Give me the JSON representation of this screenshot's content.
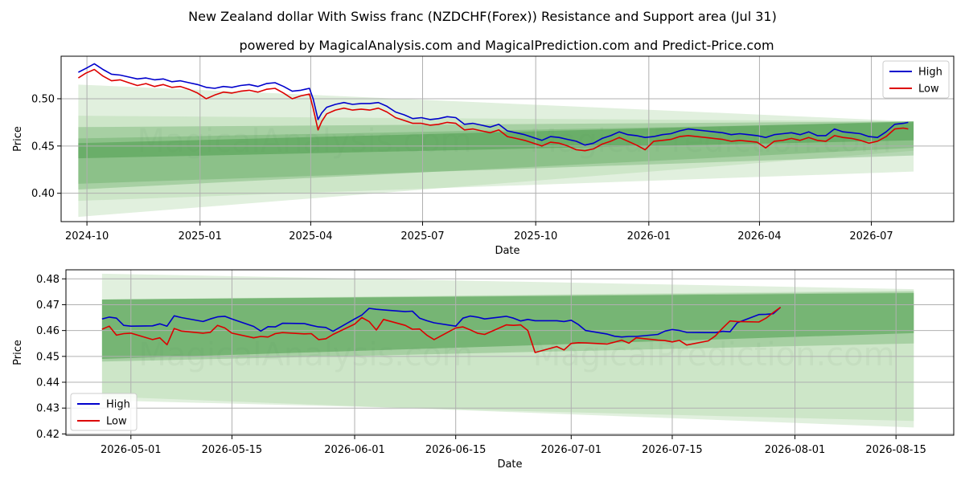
{
  "page": {
    "title": "New Zealand dollar With Swiss franc (NZDCHF(Forex)) Resistance and Support area (Jul 31)",
    "subtitle": "powered by MagicalAnalysis.com and MagicalPrediction.com and Predict-Price.com",
    "watermarks": [
      "MagicalAnalysis.com",
      "MagicalPrediction.com"
    ]
  },
  "colors": {
    "high": "#0000cc",
    "low": "#dd0000",
    "band_light": "#a8d5a0",
    "band_dark": "#4f9e4f",
    "grid": "#b0b0b0"
  },
  "chart_data": [
    {
      "type": "line",
      "xlabel": "Date",
      "ylabel": "Price",
      "ylim": [
        0.37,
        0.545
      ],
      "xlim": [
        "2024-09-10",
        "2026-09-06"
      ],
      "x_ticks": [
        "2024-10",
        "2025-01",
        "2025-04",
        "2025-07",
        "2025-10",
        "2026-01",
        "2026-04",
        "2026-07"
      ],
      "x_tick_dates": [
        "2024-10-01",
        "2025-01-01",
        "2025-04-01",
        "2025-07-01",
        "2025-10-01",
        "2026-01-01",
        "2026-04-01",
        "2026-07-01"
      ],
      "y_ticks": [
        "0.40",
        "0.45",
        "0.50"
      ],
      "y_tick_values": [
        0.4,
        0.45,
        0.5
      ],
      "grid": true,
      "legend_position": "top-right",
      "series": [
        {
          "name": "High",
          "dates": [
            "2024-09-24",
            "2024-09-30",
            "2024-10-07",
            "2024-10-14",
            "2024-10-21",
            "2024-10-28",
            "2024-11-04",
            "2024-11-11",
            "2024-11-18",
            "2024-11-25",
            "2024-12-02",
            "2024-12-09",
            "2024-12-16",
            "2024-12-23",
            "2024-12-30",
            "2025-01-06",
            "2025-01-13",
            "2025-01-20",
            "2025-01-27",
            "2025-02-03",
            "2025-02-10",
            "2025-02-17",
            "2025-02-24",
            "2025-03-03",
            "2025-03-10",
            "2025-03-17",
            "2025-03-24",
            "2025-03-31",
            "2025-04-03",
            "2025-04-07",
            "2025-04-10",
            "2025-04-14",
            "2025-04-21",
            "2025-04-28",
            "2025-05-05",
            "2025-05-12",
            "2025-05-19",
            "2025-05-26",
            "2025-06-02",
            "2025-06-09",
            "2025-06-16",
            "2025-06-23",
            "2025-06-30",
            "2025-07-07",
            "2025-07-14",
            "2025-07-21",
            "2025-07-28",
            "2025-08-04",
            "2025-08-11",
            "2025-08-18",
            "2025-08-25",
            "2025-09-01",
            "2025-09-08",
            "2025-09-15",
            "2025-09-22",
            "2025-09-29",
            "2025-10-06",
            "2025-10-13",
            "2025-10-20",
            "2025-10-27",
            "2025-11-03",
            "2025-11-10",
            "2025-11-17",
            "2025-11-24",
            "2025-12-01",
            "2025-12-08",
            "2025-12-15",
            "2025-12-22",
            "2025-12-29",
            "2026-01-05",
            "2026-01-12",
            "2026-01-19",
            "2026-01-26",
            "2026-02-02",
            "2026-02-09",
            "2026-02-16",
            "2026-02-23",
            "2026-03-02",
            "2026-03-09",
            "2026-03-16",
            "2026-03-23",
            "2026-03-30",
            "2026-04-06",
            "2026-04-13",
            "2026-04-20",
            "2026-04-27",
            "2026-05-04",
            "2026-05-11",
            "2026-05-18",
            "2026-05-25",
            "2026-06-01",
            "2026-06-08",
            "2026-06-15",
            "2026-06-22",
            "2026-06-29",
            "2026-07-06",
            "2026-07-13",
            "2026-07-20",
            "2026-07-27",
            "2026-07-31"
          ],
          "values": [
            0.528,
            0.532,
            0.537,
            0.531,
            0.526,
            0.525,
            0.523,
            0.521,
            0.522,
            0.52,
            0.521,
            0.518,
            0.519,
            0.517,
            0.515,
            0.512,
            0.511,
            0.513,
            0.512,
            0.514,
            0.515,
            0.513,
            0.516,
            0.517,
            0.513,
            0.508,
            0.509,
            0.511,
            0.5,
            0.478,
            0.485,
            0.491,
            0.494,
            0.496,
            0.494,
            0.495,
            0.495,
            0.496,
            0.492,
            0.486,
            0.483,
            0.479,
            0.48,
            0.478,
            0.479,
            0.481,
            0.48,
            0.473,
            0.474,
            0.472,
            0.47,
            0.473,
            0.466,
            0.464,
            0.462,
            0.459,
            0.456,
            0.46,
            0.459,
            0.457,
            0.455,
            0.451,
            0.453,
            0.458,
            0.461,
            0.465,
            0.462,
            0.461,
            0.459,
            0.46,
            0.462,
            0.463,
            0.466,
            0.468,
            0.467,
            0.466,
            0.465,
            0.464,
            0.462,
            0.463,
            0.462,
            0.461,
            0.459,
            0.462,
            0.463,
            0.464,
            0.462,
            0.465,
            0.461,
            0.461,
            0.468,
            0.465,
            0.464,
            0.463,
            0.46,
            0.459,
            0.465,
            0.473,
            0.474,
            0.475
          ]
        },
        {
          "name": "Low",
          "dates": [
            "2024-09-24",
            "2024-09-30",
            "2024-10-07",
            "2024-10-14",
            "2024-10-21",
            "2024-10-28",
            "2024-11-04",
            "2024-11-11",
            "2024-11-18",
            "2024-11-25",
            "2024-12-02",
            "2024-12-09",
            "2024-12-16",
            "2024-12-23",
            "2024-12-30",
            "2025-01-06",
            "2025-01-13",
            "2025-01-20",
            "2025-01-27",
            "2025-02-03",
            "2025-02-10",
            "2025-02-17",
            "2025-02-24",
            "2025-03-03",
            "2025-03-10",
            "2025-03-17",
            "2025-03-24",
            "2025-03-31",
            "2025-04-03",
            "2025-04-07",
            "2025-04-10",
            "2025-04-14",
            "2025-04-21",
            "2025-04-28",
            "2025-05-05",
            "2025-05-12",
            "2025-05-19",
            "2025-05-26",
            "2025-06-02",
            "2025-06-09",
            "2025-06-16",
            "2025-06-23",
            "2025-06-30",
            "2025-07-07",
            "2025-07-14",
            "2025-07-21",
            "2025-07-28",
            "2025-08-04",
            "2025-08-11",
            "2025-08-18",
            "2025-08-25",
            "2025-09-01",
            "2025-09-08",
            "2025-09-15",
            "2025-09-22",
            "2025-09-29",
            "2025-10-06",
            "2025-10-13",
            "2025-10-20",
            "2025-10-27",
            "2025-11-03",
            "2025-11-10",
            "2025-11-17",
            "2025-11-24",
            "2025-12-01",
            "2025-12-08",
            "2025-12-15",
            "2025-12-22",
            "2025-12-29",
            "2026-01-05",
            "2026-01-12",
            "2026-01-19",
            "2026-01-26",
            "2026-02-02",
            "2026-02-09",
            "2026-02-16",
            "2026-02-23",
            "2026-03-02",
            "2026-03-09",
            "2026-03-16",
            "2026-03-23",
            "2026-03-30",
            "2026-04-06",
            "2026-04-13",
            "2026-04-20",
            "2026-04-27",
            "2026-05-04",
            "2026-05-11",
            "2026-05-18",
            "2026-05-25",
            "2026-06-01",
            "2026-06-08",
            "2026-06-15",
            "2026-06-22",
            "2026-06-29",
            "2026-07-06",
            "2026-07-13",
            "2026-07-20",
            "2026-07-27",
            "2026-07-31"
          ],
          "values": [
            0.522,
            0.527,
            0.531,
            0.524,
            0.519,
            0.52,
            0.517,
            0.514,
            0.516,
            0.513,
            0.515,
            0.512,
            0.513,
            0.51,
            0.506,
            0.5,
            0.504,
            0.507,
            0.506,
            0.508,
            0.509,
            0.507,
            0.51,
            0.511,
            0.506,
            0.5,
            0.503,
            0.505,
            0.49,
            0.467,
            0.476,
            0.484,
            0.488,
            0.49,
            0.488,
            0.489,
            0.488,
            0.49,
            0.486,
            0.48,
            0.477,
            0.474,
            0.474,
            0.472,
            0.473,
            0.475,
            0.474,
            0.467,
            0.468,
            0.466,
            0.464,
            0.467,
            0.46,
            0.458,
            0.456,
            0.453,
            0.45,
            0.454,
            0.453,
            0.45,
            0.446,
            0.445,
            0.447,
            0.452,
            0.455,
            0.459,
            0.455,
            0.451,
            0.446,
            0.455,
            0.456,
            0.457,
            0.46,
            0.461,
            0.46,
            0.459,
            0.458,
            0.457,
            0.455,
            0.456,
            0.455,
            0.454,
            0.448,
            0.455,
            0.456,
            0.458,
            0.456,
            0.459,
            0.456,
            0.455,
            0.461,
            0.459,
            0.458,
            0.456,
            0.453,
            0.455,
            0.46,
            0.468,
            0.469,
            0.468
          ]
        }
      ],
      "bands": [
        {
          "level": "light",
          "start": [
            0.375,
            0.515
          ],
          "end": [
            0.445,
            0.476
          ]
        },
        {
          "level": "light",
          "start": [
            0.392,
            0.482
          ],
          "end": [
            0.423,
            0.476
          ]
        },
        {
          "level": "medium",
          "start": [
            0.41,
            0.458
          ],
          "end": [
            0.44,
            0.475
          ]
        },
        {
          "level": "medium",
          "start": [
            0.404,
            0.47
          ],
          "end": [
            0.448,
            0.476
          ]
        },
        {
          "level": "dark",
          "start": [
            0.437,
            0.453
          ],
          "end": [
            0.456,
            0.476
          ]
        }
      ]
    },
    {
      "type": "line",
      "xlabel": "Date",
      "ylabel": "Price",
      "ylim": [
        0.4195,
        0.4835
      ],
      "xlim": [
        "2026-04-22",
        "2026-08-23"
      ],
      "x_ticks": [
        "2026-05-01",
        "2026-05-15",
        "2026-06-01",
        "2026-06-15",
        "2026-07-01",
        "2026-07-15",
        "2026-08-01",
        "2026-08-15"
      ],
      "y_ticks": [
        "0.42",
        "0.43",
        "0.44",
        "0.45",
        "0.46",
        "0.47",
        "0.48"
      ],
      "y_tick_values": [
        0.42,
        0.43,
        0.44,
        0.45,
        0.46,
        0.47,
        0.48
      ],
      "grid": true,
      "legend_position": "bottom-left",
      "series": [
        {
          "name": "High",
          "dates": [
            "2026-04-27",
            "2026-04-28",
            "2026-04-29",
            "2026-04-30",
            "2026-05-01",
            "2026-05-04",
            "2026-05-05",
            "2026-05-06",
            "2026-05-07",
            "2026-05-08",
            "2026-05-11",
            "2026-05-12",
            "2026-05-13",
            "2026-05-14",
            "2026-05-15",
            "2026-05-18",
            "2026-05-19",
            "2026-05-20",
            "2026-05-21",
            "2026-05-22",
            "2026-05-25",
            "2026-05-26",
            "2026-05-27",
            "2026-05-28",
            "2026-05-29",
            "2026-06-01",
            "2026-06-02",
            "2026-06-03",
            "2026-06-04",
            "2026-06-05",
            "2026-06-08",
            "2026-06-09",
            "2026-06-10",
            "2026-06-11",
            "2026-06-12",
            "2026-06-15",
            "2026-06-16",
            "2026-06-17",
            "2026-06-18",
            "2026-06-19",
            "2026-06-22",
            "2026-06-23",
            "2026-06-24",
            "2026-06-25",
            "2026-06-26",
            "2026-06-29",
            "2026-06-30",
            "2026-07-01",
            "2026-07-02",
            "2026-07-03",
            "2026-07-06",
            "2026-07-07",
            "2026-07-08",
            "2026-07-09",
            "2026-07-10",
            "2026-07-13",
            "2026-07-14",
            "2026-07-15",
            "2026-07-16",
            "2026-07-17",
            "2026-07-20",
            "2026-07-21",
            "2026-07-22",
            "2026-07-23",
            "2026-07-24",
            "2026-07-27",
            "2026-07-28",
            "2026-07-29",
            "2026-07-30"
          ],
          "values": [
            0.4645,
            0.4652,
            0.4648,
            0.462,
            0.4617,
            0.4618,
            0.4626,
            0.4617,
            0.4657,
            0.465,
            0.4635,
            0.4645,
            0.4653,
            0.4655,
            0.4645,
            0.4616,
            0.4598,
            0.4615,
            0.4614,
            0.4628,
            0.4627,
            0.462,
            0.4614,
            0.4612,
            0.4597,
            0.4645,
            0.466,
            0.4686,
            0.4682,
            0.468,
            0.4673,
            0.4675,
            0.4648,
            0.4638,
            0.463,
            0.4617,
            0.4648,
            0.4656,
            0.4652,
            0.4645,
            0.4655,
            0.4648,
            0.4637,
            0.4643,
            0.4638,
            0.4638,
            0.4635,
            0.464,
            0.4623,
            0.46,
            0.4586,
            0.4578,
            0.4575,
            0.4577,
            0.4577,
            0.4585,
            0.4598,
            0.4604,
            0.46,
            0.4593,
            0.4592,
            0.4592,
            0.4597,
            0.4595,
            0.463,
            0.4662,
            0.4663,
            0.4665,
            0.469
          ]
        },
        {
          "name": "Low",
          "dates": [
            "2026-04-27",
            "2026-04-28",
            "2026-04-29",
            "2026-04-30",
            "2026-05-01",
            "2026-05-04",
            "2026-05-05",
            "2026-05-06",
            "2026-05-07",
            "2026-05-08",
            "2026-05-11",
            "2026-05-12",
            "2026-05-13",
            "2026-05-14",
            "2026-05-15",
            "2026-05-18",
            "2026-05-19",
            "2026-05-20",
            "2026-05-21",
            "2026-05-22",
            "2026-05-25",
            "2026-05-26",
            "2026-05-27",
            "2026-05-28",
            "2026-05-29",
            "2026-06-01",
            "2026-06-02",
            "2026-06-03",
            "2026-06-04",
            "2026-06-05",
            "2026-06-08",
            "2026-06-09",
            "2026-06-10",
            "2026-06-11",
            "2026-06-12",
            "2026-06-15",
            "2026-06-16",
            "2026-06-17",
            "2026-06-18",
            "2026-06-19",
            "2026-06-22",
            "2026-06-23",
            "2026-06-24",
            "2026-06-25",
            "2026-06-26",
            "2026-06-29",
            "2026-06-30",
            "2026-07-01",
            "2026-07-02",
            "2026-07-03",
            "2026-07-06",
            "2026-07-07",
            "2026-07-08",
            "2026-07-09",
            "2026-07-10",
            "2026-07-13",
            "2026-07-14",
            "2026-07-15",
            "2026-07-16",
            "2026-07-17",
            "2026-07-20",
            "2026-07-21",
            "2026-07-22",
            "2026-07-23",
            "2026-07-24",
            "2026-07-27",
            "2026-07-28",
            "2026-07-29",
            "2026-07-30"
          ],
          "values": [
            0.4605,
            0.4617,
            0.4582,
            0.4588,
            0.459,
            0.4565,
            0.4572,
            0.4545,
            0.4608,
            0.4598,
            0.459,
            0.4593,
            0.462,
            0.461,
            0.459,
            0.4572,
            0.4577,
            0.4575,
            0.4588,
            0.4592,
            0.4587,
            0.4588,
            0.4565,
            0.4568,
            0.4585,
            0.4625,
            0.465,
            0.4635,
            0.4602,
            0.4643,
            0.462,
            0.4605,
            0.4606,
            0.4582,
            0.4565,
            0.461,
            0.4614,
            0.4603,
            0.459,
            0.4585,
            0.4622,
            0.462,
            0.4622,
            0.46,
            0.4515,
            0.4538,
            0.4525,
            0.455,
            0.4553,
            0.4552,
            0.4548,
            0.4555,
            0.4563,
            0.4551,
            0.4572,
            0.4563,
            0.4561,
            0.4556,
            0.4562,
            0.4544,
            0.456,
            0.458,
            0.461,
            0.4637,
            0.4635,
            0.4633,
            0.4648,
            0.467,
            0.469
          ]
        }
      ],
      "bands": [
        {
          "level": "light",
          "start": [
            0.4345,
            0.482
          ],
          "end": [
            0.4225,
            0.476
          ]
        },
        {
          "level": "light",
          "start": [
            0.433,
            0.472
          ],
          "end": [
            0.425,
            0.4755
          ]
        },
        {
          "level": "medium",
          "start": [
            0.448,
            0.472
          ],
          "end": [
            0.455,
            0.475
          ]
        },
        {
          "level": "dark",
          "start": [
            0.449,
            0.472
          ],
          "end": [
            0.459,
            0.4745
          ]
        }
      ]
    }
  ]
}
